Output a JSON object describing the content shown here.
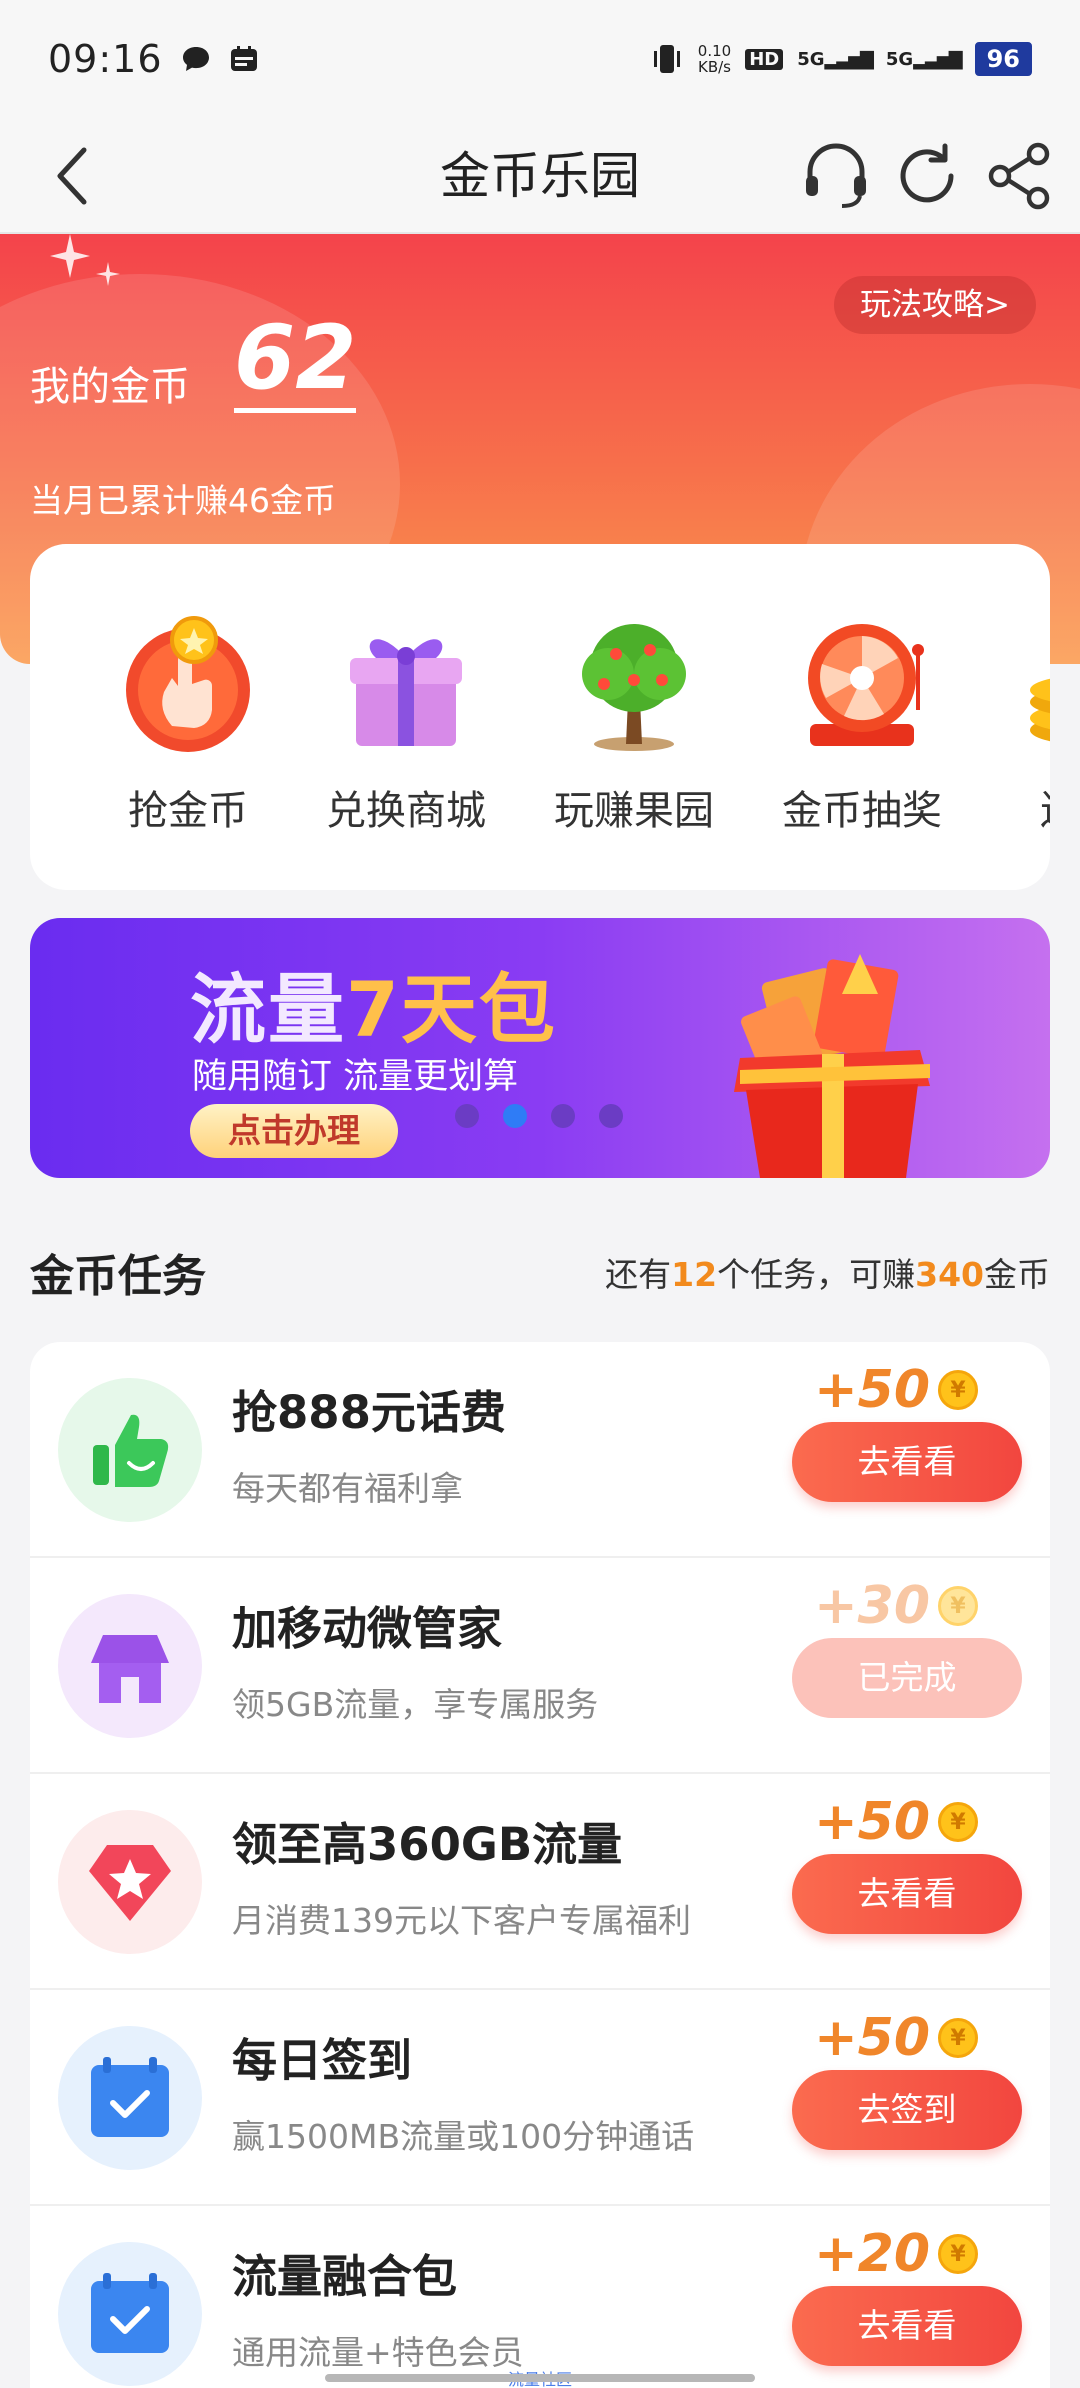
{
  "status_bar": {
    "time": "09:16",
    "net_speed_value": "0.10",
    "net_speed_unit": "KB/s",
    "hd_label": "HD",
    "sim1": "5G",
    "sim2": "5G",
    "battery": "96"
  },
  "nav": {
    "title": "金币乐园"
  },
  "hero": {
    "coin_label": "我的金币",
    "coin_value": "62",
    "month_earned": "当月已累计赚46金币",
    "guide_button": "玩法攻略>"
  },
  "shortcuts": [
    {
      "label": "抢金币",
      "icon": "hand-coin-icon"
    },
    {
      "label": "兑换商城",
      "icon": "gift-box-icon"
    },
    {
      "label": "玩赚果园",
      "icon": "tree-icon"
    },
    {
      "label": "金币抽奖",
      "icon": "lottery-wheel-icon"
    },
    {
      "label": "送金",
      "icon": "coin-stack-icon"
    }
  ],
  "banner": {
    "title_part1": "流量",
    "title_part2": "7天包",
    "subtitle": "随用随订 流量更划算",
    "cta": "点击办理",
    "active_slide": 2,
    "slide_count": 4
  },
  "tasks_section": {
    "title": "金币任务",
    "summary_prefix": "还有",
    "remaining": "12",
    "summary_mid": "个任务，可赚",
    "coins": "340",
    "summary_suffix": "金币"
  },
  "tasks": [
    {
      "title": "抢888元话费",
      "desc": "每天都有福利拿",
      "reward": "+50",
      "button": "去看看",
      "done": false,
      "icon": "thumbs-up-icon"
    },
    {
      "title": "加移动微管家",
      "desc": "领5GB流量，享专属服务",
      "reward": "+30",
      "button": "已完成",
      "done": true,
      "icon": "house-icon"
    },
    {
      "title": "领至高360GB流量",
      "desc": "月消费139元以下客户专属福利",
      "reward": "+50",
      "button": "去看看",
      "done": false,
      "icon": "star-badge-icon"
    },
    {
      "title": "每日签到",
      "desc": "赢1500MB流量或100分钟通话",
      "reward": "+50",
      "button": "去签到",
      "done": false,
      "icon": "calendar-check-icon"
    },
    {
      "title": "流量融合包",
      "desc": "通用流量+特色会员",
      "reward": "+20",
      "button": "去看看",
      "done": false,
      "icon": "calendar-check-icon"
    }
  ],
  "coin_symbol": "¥",
  "bottom_tag": "流量社区",
  "colors": {
    "accent_orange": "#f0862a",
    "button_red": "#f2463f",
    "hero_top": "#f4434b",
    "banner_purple": "#6a2cf0"
  }
}
